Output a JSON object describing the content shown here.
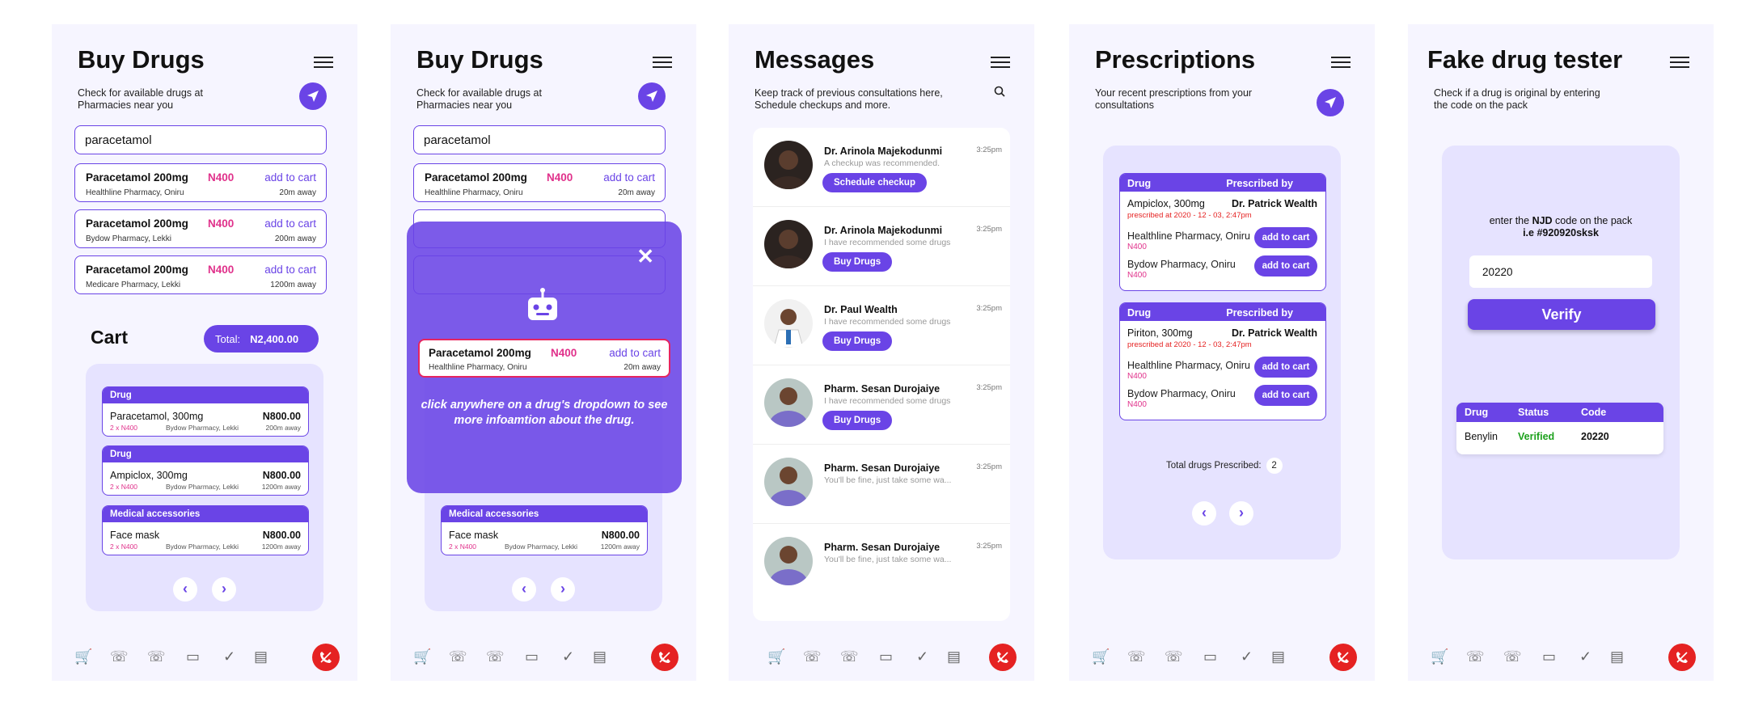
{
  "icons": {
    "menu": "hamburger-menu-icon",
    "locate": "navigation-arrow-icon",
    "search": "search-icon",
    "close": "close-icon",
    "bot": "robot-icon",
    "call": "phone-call-icon"
  },
  "colors": {
    "accent": "#6a44e6",
    "price": "#e0318b",
    "panel": "#e6e3ff",
    "call": "#e52222",
    "verified": "#1da11d"
  },
  "buy": {
    "title": "Buy Drugs",
    "subtitle_l1": "Check for available drugs at",
    "subtitle_l2": "Pharmacies near you",
    "search": "paracetamol",
    "results": [
      {
        "name": "Paracetamol 200mg",
        "price": "N400",
        "action": "add to cart",
        "pharmacy": "Healthline Pharmacy, Oniru",
        "dist": "20m away"
      },
      {
        "name": "Paracetamol 200mg",
        "price": "N400",
        "action": "add to cart",
        "pharmacy": "Bydow Pharmacy, Lekki",
        "dist": "200m away"
      },
      {
        "name": "Paracetamol 200mg",
        "price": "N400",
        "action": "add to cart",
        "pharmacy": "Medicare Pharmacy, Lekki",
        "dist": "1200m away"
      }
    ],
    "cart": {
      "label": "Cart",
      "total_label": "Total:",
      "total": "N2,400.00",
      "items": [
        {
          "cat": "Drug",
          "name": "Paracetamol, 300mg",
          "price": "N800.00",
          "qty": "2 x N400",
          "pharmacy": "Bydow Pharmacy, Lekki",
          "dist": "200m away"
        },
        {
          "cat": "Drug",
          "name": "Ampiclox, 300mg",
          "price": "N800.00",
          "qty": "2 x N400",
          "pharmacy": "Bydow Pharmacy, Lekki",
          "dist": "1200m away"
        },
        {
          "cat": "Medical accessories",
          "name": "Face mask",
          "price": "N800.00",
          "qty": "2 x N400",
          "pharmacy": "Bydow Pharmacy, Lekki",
          "dist": "1200m away"
        }
      ]
    }
  },
  "overlay": {
    "hint": "click anywhere on a drug's dropdown to see more infoamtion about the drug."
  },
  "messages": {
    "title": "Messages",
    "subtitle_l1": "Keep track of previous consultations here,",
    "subtitle_l2": "Schedule checkups and more.",
    "items": [
      {
        "name": "Dr. Arinola Majekodunmi",
        "time": "3:25pm",
        "text": "A checkup was recommended.",
        "button": "Schedule checkup"
      },
      {
        "name": "Dr. Arinola Majekodunmi",
        "time": "3:25pm",
        "text": "I have recommended some drugs",
        "button": "Buy Drugs"
      },
      {
        "name": "Dr. Paul Wealth",
        "time": "3:25pm",
        "text": "I have recommended some drugs",
        "button": "Buy Drugs"
      },
      {
        "name": "Pharm. Sesan Durojaiye",
        "time": "3:25pm",
        "text": "I have recommended some drugs",
        "button": "Buy Drugs"
      },
      {
        "name": "Pharm. Sesan Durojaiye",
        "time": "3:25pm",
        "text": "You'll be fine, just take some  wa...",
        "button": ""
      },
      {
        "name": "Pharm. Sesan Durojaiye",
        "time": "3:25pm",
        "text": "You'll be fine, just take some  wa...",
        "button": ""
      }
    ]
  },
  "prescriptions": {
    "title": "Prescriptions",
    "subtitle_l1": "Your recent prescriptions from your",
    "subtitle_l2": "consultations",
    "col_drug": "Drug",
    "col_by": "Prescribed by",
    "cards": [
      {
        "drug": "Ampiclox, 300mg",
        "doctor": "Dr. Patrick Wealth",
        "date": "prescribed at 2020 - 12 - 03, 2:47pm",
        "pharmacies": [
          {
            "name": "Healthline Pharmacy, Oniru",
            "price": "N400",
            "action": "add to cart"
          },
          {
            "name": "Bydow Pharmacy, Oniru",
            "price": "N400",
            "action": "add to cart"
          }
        ]
      },
      {
        "drug": "Piriton, 300mg",
        "doctor": "Dr. Patrick Wealth",
        "date": "prescribed at 2020 - 12 - 03, 2:47pm",
        "pharmacies": [
          {
            "name": "Healthline Pharmacy, Oniru",
            "price": "N400",
            "action": "add to cart"
          },
          {
            "name": "Bydow Pharmacy, Oniru",
            "price": "N400",
            "action": "add to cart"
          }
        ]
      }
    ],
    "total_label": "Total drugs Prescribed:",
    "total": "2"
  },
  "tester": {
    "title": "Fake drug tester",
    "subtitle_l1": "Check if a drug is original by entering",
    "subtitle_l2": "the code on the pack",
    "instr_pre": "enter the ",
    "instr_bold": "NJD",
    "instr_post": " code on the pack",
    "instr_l2_pre": "i.e ",
    "instr_l2_bold": "#920920sksk",
    "input": "20220",
    "verify": "Verify",
    "table": {
      "headers": [
        "Drug",
        "Status",
        "Code"
      ],
      "row": [
        "Benylin",
        "Verified",
        "20220"
      ]
    }
  }
}
